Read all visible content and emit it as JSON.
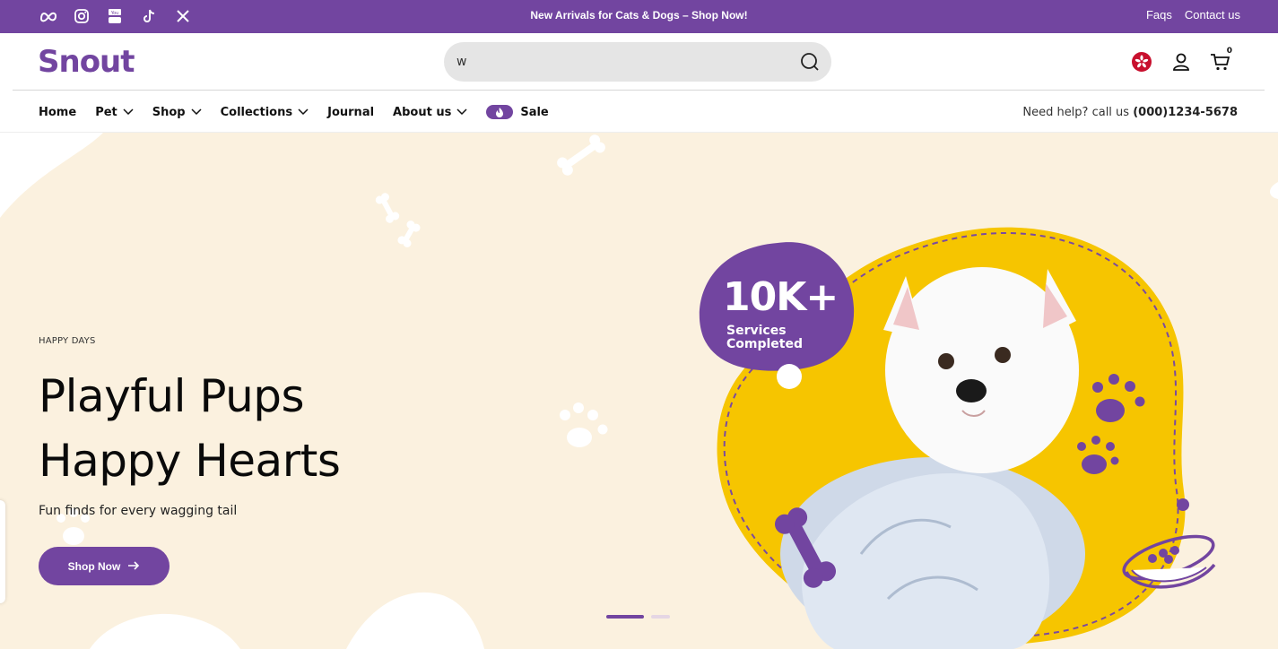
{
  "topbar": {
    "social": [
      {
        "icon": "meta-icon"
      },
      {
        "icon": "instagram-icon"
      },
      {
        "icon": "youtube-icon"
      },
      {
        "icon": "tiktok-icon"
      },
      {
        "icon": "x-icon"
      }
    ],
    "announcement": "New Arrivals for Cats & Dogs – Shop Now!",
    "links": [
      "Faqs",
      "Contact us"
    ]
  },
  "header": {
    "logo": "Snout",
    "search_value": "w",
    "cart_count": "0",
    "flag_icon": "hong-kong-flag-icon"
  },
  "nav": {
    "items": [
      "Home",
      "Pet",
      "Shop",
      "Collections",
      "Journal",
      "About us"
    ],
    "sale_label": "Sale",
    "help_text": "Need help? call us",
    "phone": "(000)1234-5678"
  },
  "hero": {
    "eyebrow": "HAPPY DAYS",
    "headline_line1": "Playful Pups",
    "headline_line2": "Happy Hearts",
    "subhead": "Fun finds for every wagging tail",
    "cta": "Shop Now",
    "badge_big": "10K+",
    "badge_line1": "Services",
    "badge_line2": "Completed",
    "slides_total": 2,
    "slide_active": 1
  },
  "colors": {
    "brand": "#7245a0",
    "hero_bg": "#fbf1df",
    "blob_yellow": "#f6c500"
  }
}
